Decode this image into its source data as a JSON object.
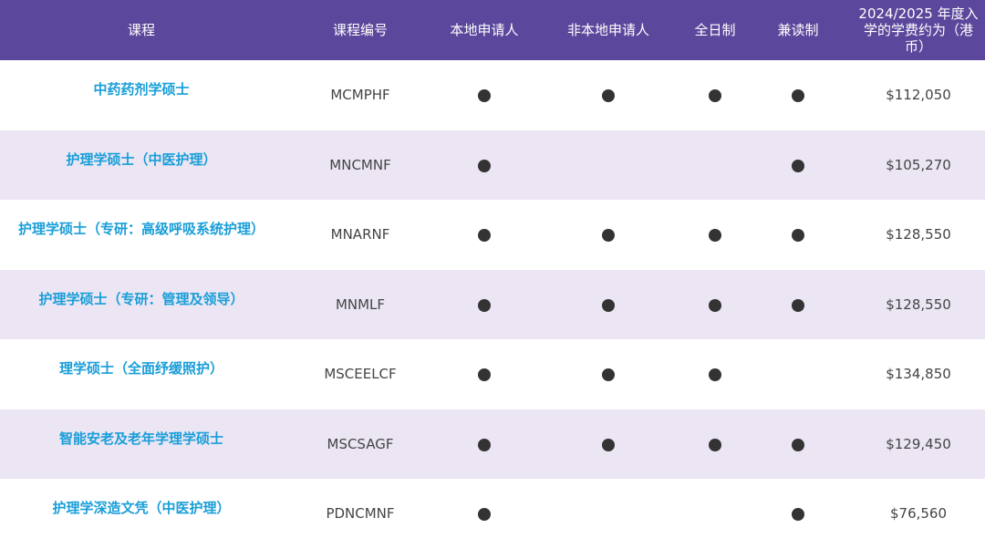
{
  "headers": [
    "课程",
    "课程编号",
    "本地申请人",
    "非本地申请人",
    "全日制",
    "兼读制",
    "2024/2025 年度入学的学费约为（港币）"
  ],
  "rows": [
    {
      "course": "中药药剂学硕士",
      "code": "MCMPHF",
      "local": true,
      "nonlocal": true,
      "fulltime": true,
      "parttime": true,
      "fee": "$112,050"
    },
    {
      "course": "护理学硕士（中医护理）",
      "code": "MNCMNF",
      "local": true,
      "nonlocal": false,
      "fulltime": false,
      "parttime": true,
      "fee": "$105,270"
    },
    {
      "course": "护理学硕士（专研：高级呼吸系统护理）",
      "code": "MNARNF",
      "local": true,
      "nonlocal": true,
      "fulltime": true,
      "parttime": true,
      "fee": "$128,550"
    },
    {
      "course": "护理学硕士（专研：管理及领导）",
      "code": "MNMLF",
      "local": true,
      "nonlocal": true,
      "fulltime": true,
      "parttime": true,
      "fee": "$128,550"
    },
    {
      "course": "理学硕士（全面纾缓照护）",
      "code": "MSCEELCF",
      "local": true,
      "nonlocal": true,
      "fulltime": true,
      "parttime": false,
      "fee": "$134,850"
    },
    {
      "course": "智能安老及老年学理学硕士",
      "code": "MSCSAGF",
      "local": true,
      "nonlocal": true,
      "fulltime": true,
      "parttime": true,
      "fee": "$129,450"
    },
    {
      "course": "护理学深造文凭（中医护理）",
      "code": "PDNCMNF",
      "local": true,
      "nonlocal": false,
      "fulltime": false,
      "parttime": true,
      "fee": "$76,560"
    }
  ],
  "colors": {
    "header_bg": "#5b479b",
    "alt_row_bg": "#ece6f4",
    "course_text": "#199ed8",
    "dot": "#333333"
  }
}
